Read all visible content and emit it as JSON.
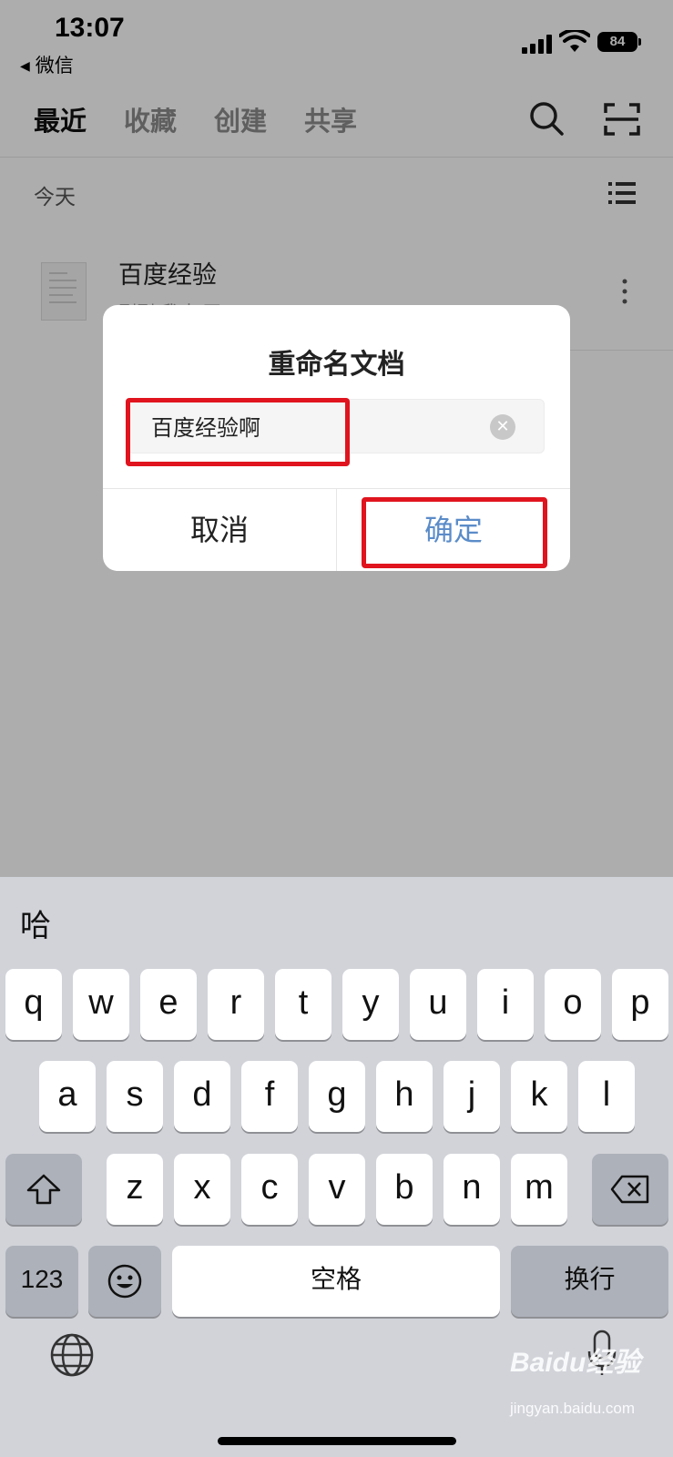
{
  "status_bar": {
    "time": "13:07",
    "back_app": "微信",
    "battery": "84"
  },
  "header": {
    "tabs": [
      {
        "label": "最近",
        "active": true
      },
      {
        "label": "收藏",
        "active": false
      },
      {
        "label": "创建",
        "active": false
      },
      {
        "label": "共享",
        "active": false
      }
    ],
    "icons": [
      "search-icon",
      "scan-icon"
    ]
  },
  "list": {
    "section_label": "今天",
    "files": [
      {
        "name": "百度经验",
        "subtitle": "刚刚 我 打开"
      }
    ]
  },
  "dialog": {
    "title": "重命名文档",
    "input_value": "百度经验啊",
    "cancel_label": "取消",
    "confirm_label": "确定",
    "confirm_color": "#5b8cc9",
    "highlight_color": "#e0141e"
  },
  "keyboard": {
    "candidate": "哈",
    "row1": [
      "q",
      "w",
      "e",
      "r",
      "t",
      "y",
      "u",
      "i",
      "o",
      "p"
    ],
    "row2": [
      "a",
      "s",
      "d",
      "f",
      "g",
      "h",
      "j",
      "k",
      "l"
    ],
    "row3": [
      "z",
      "x",
      "c",
      "v",
      "b",
      "n",
      "m"
    ],
    "numbers_key": "123",
    "space_key": "空格",
    "return_key": "换行",
    "icons": [
      "shift-icon",
      "delete-icon",
      "emoji-icon",
      "globe-icon",
      "mic-icon"
    ]
  },
  "watermark": {
    "logo": "Baidu经验",
    "url": "jingyan.baidu.com"
  }
}
